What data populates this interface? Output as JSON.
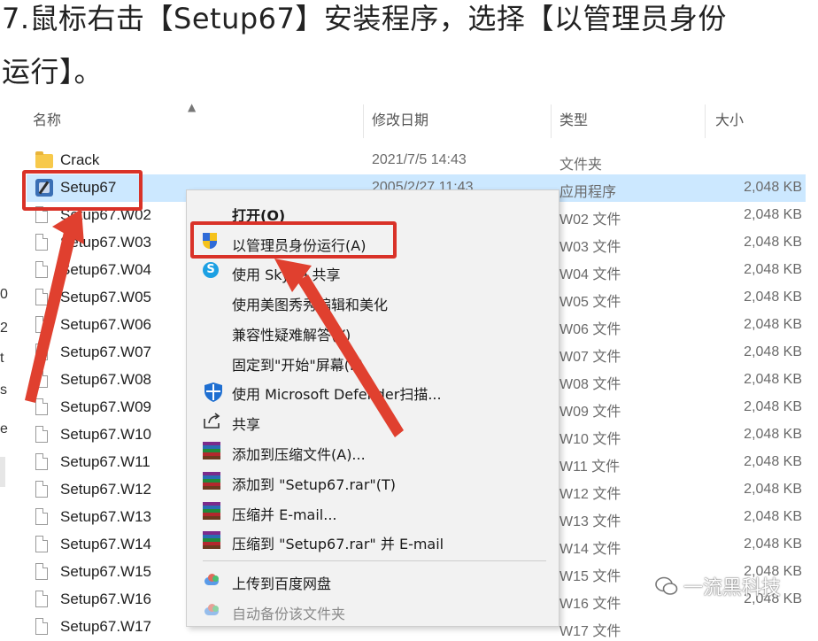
{
  "instruction": {
    "line1": "7.鼠标右击【Setup67】安装程序，选择【以管理员身份",
    "line2": "运行】。"
  },
  "left_strip": {
    "chars": [
      "0",
      "2",
      "t",
      "s",
      "e"
    ]
  },
  "columns": {
    "name": "名称",
    "date": "修改日期",
    "type": "类型",
    "size": "大小"
  },
  "rows": [
    {
      "name": "Crack",
      "date": "2021/7/5 14:43",
      "type": "文件夹",
      "size": "",
      "icon": "folder-icon"
    },
    {
      "name": "Setup67",
      "date": "2005/2/27 11:43",
      "type": "应用程序",
      "size": "2,048 KB",
      "icon": "setup-exe-icon"
    },
    {
      "name": "Setup67.W02",
      "type": "W02 文件",
      "size": "2,048 KB",
      "icon": "file-icon"
    },
    {
      "name": "Setup67.W03",
      "type": "W03 文件",
      "size": "2,048 KB",
      "icon": "file-icon"
    },
    {
      "name": "Setup67.W04",
      "type": "W04 文件",
      "size": "2,048 KB",
      "icon": "file-icon"
    },
    {
      "name": "Setup67.W05",
      "type": "W05 文件",
      "size": "2,048 KB",
      "icon": "file-icon"
    },
    {
      "name": "Setup67.W06",
      "type": "W06 文件",
      "size": "2,048 KB",
      "icon": "file-icon"
    },
    {
      "name": "Setup67.W07",
      "type": "W07 文件",
      "size": "2,048 KB",
      "icon": "file-icon"
    },
    {
      "name": "Setup67.W08",
      "type": "W08 文件",
      "size": "2,048 KB",
      "icon": "file-icon"
    },
    {
      "name": "Setup67.W09",
      "type": "W09 文件",
      "size": "2,048 KB",
      "icon": "file-icon"
    },
    {
      "name": "Setup67.W10",
      "type": "W10 文件",
      "size": "2,048 KB",
      "icon": "file-icon"
    },
    {
      "name": "Setup67.W11",
      "type": "W11 文件",
      "size": "2,048 KB",
      "icon": "file-icon"
    },
    {
      "name": "Setup67.W12",
      "type": "W12 文件",
      "size": "2,048 KB",
      "icon": "file-icon"
    },
    {
      "name": "Setup67.W13",
      "type": "W13 文件",
      "size": "2,048 KB",
      "icon": "file-icon"
    },
    {
      "name": "Setup67.W14",
      "type": "W14 文件",
      "size": "2,048 KB",
      "icon": "file-icon"
    },
    {
      "name": "Setup67.W15",
      "type": "W15 文件",
      "size": "2,048 KB",
      "icon": "file-icon"
    },
    {
      "name": "Setup67.W16",
      "type": "W16 文件",
      "size": "2,048 KB",
      "icon": "file-icon"
    },
    {
      "name": "Setup67.W17",
      "type": "W17 文件",
      "size": "",
      "icon": "file-icon"
    }
  ],
  "context_menu": {
    "open": "打开(O)",
    "run_as_admin": "以管理员身份运行(A)",
    "share_skype": "使用 Skype 共享",
    "meitu": "使用美图秀秀编辑和美化",
    "compat": "兼容性疑难解答(Y)",
    "pin_start": "固定到\"开始\"屏幕(P)",
    "defender": "使用 Microsoft Defender扫描...",
    "share": "共享",
    "add_archive": "添加到压缩文件(A)...",
    "add_rar": "添加到 \"Setup67.rar\"(T)",
    "compress_email": "压缩并 E-mail...",
    "compress_rar_email": "压缩到 \"Setup67.rar\" 并 E-mail",
    "upload_baidu": "上传到百度网盘",
    "auto_backup": "自动备份该文件夹"
  },
  "watermark": {
    "text": "一流黑科技"
  },
  "colors": {
    "annotation_red": "#d93228",
    "selection": "#cce8ff",
    "menu_bg": "#f2f2f2"
  }
}
